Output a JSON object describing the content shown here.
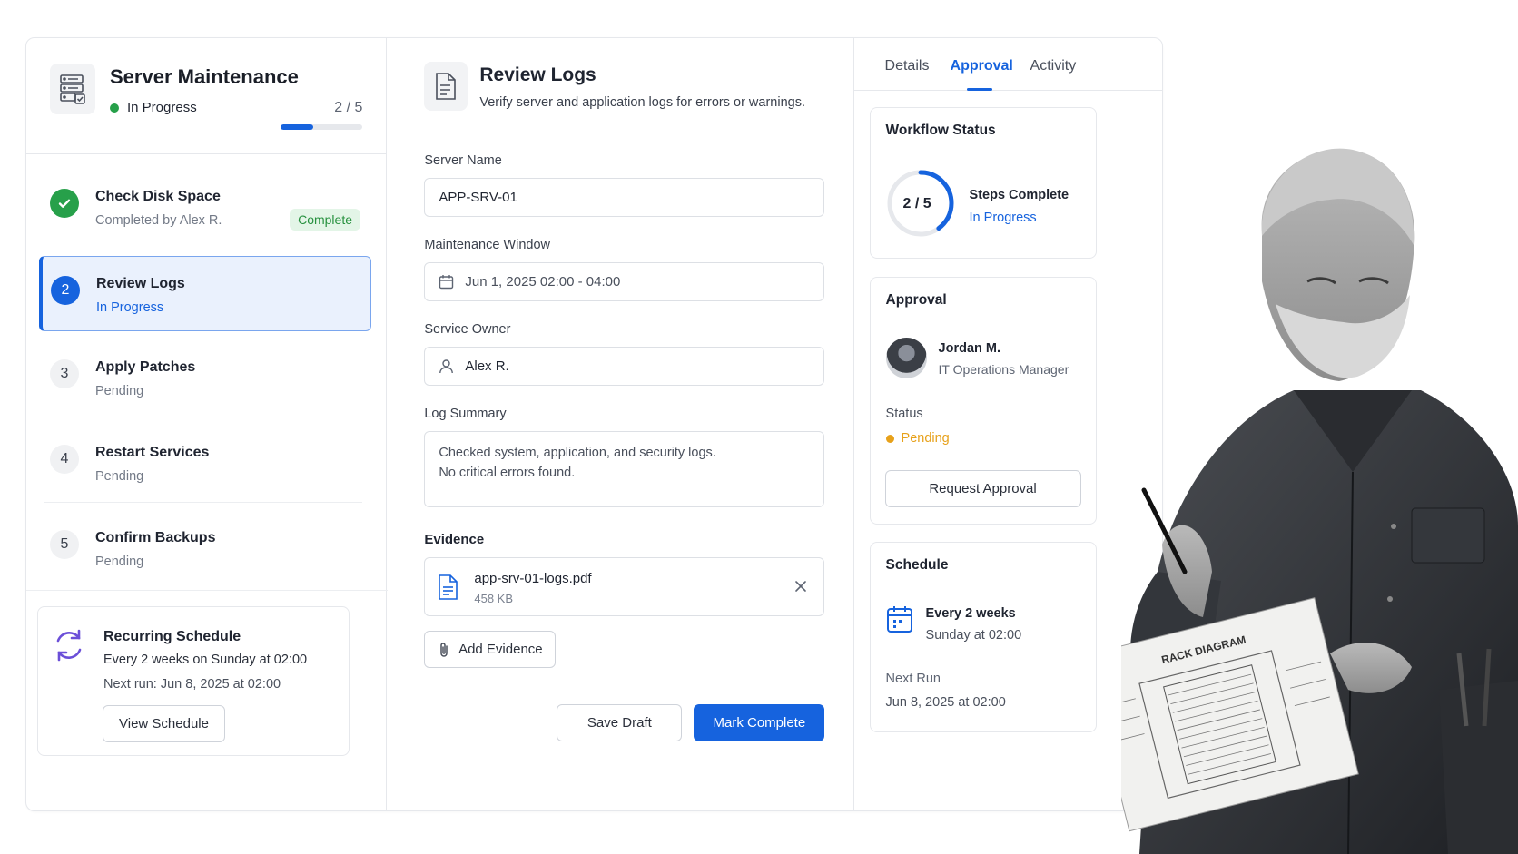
{
  "project": {
    "title": "Server Maintenance",
    "status": "In Progress",
    "progress_text": "2 / 5",
    "progress_fraction": 0.4
  },
  "steps": [
    {
      "number": "1",
      "title": "Check Disk Space",
      "subtitle": "Completed by Alex R.",
      "badge": "Complete",
      "state": "complete"
    },
    {
      "number": "2",
      "title": "Review Logs",
      "subtitle": "In Progress",
      "state": "active"
    },
    {
      "number": "3",
      "title": "Apply Patches",
      "subtitle": "Pending",
      "state": "pending"
    },
    {
      "number": "4",
      "title": "Restart Services",
      "subtitle": "Pending",
      "state": "pending"
    },
    {
      "number": "5",
      "title": "Confirm Backups",
      "subtitle": "Pending",
      "state": "pending"
    }
  ],
  "recurring": {
    "title": "Recurring Schedule",
    "frequency": "Every 2 weeks on Sunday at 02:00",
    "next_run": "Next run: Jun 8, 2025 at 02:00",
    "button": "View Schedule"
  },
  "task": {
    "title": "Review Logs",
    "description": "Verify server and application logs for errors or warnings.",
    "fields": {
      "server_name": {
        "label": "Server Name",
        "value": "APP-SRV-01"
      },
      "maintenance_window": {
        "label": "Maintenance Window",
        "value": "Jun 1, 2025 02:00 - 04:00"
      },
      "service_owner": {
        "label": "Service Owner",
        "value": "Alex R."
      },
      "log_summary": {
        "label": "Log Summary",
        "line1": "Checked system, application, and security logs.",
        "line2": "No critical errors found."
      }
    },
    "evidence": {
      "label": "Evidence",
      "file_name": "app-srv-01-logs.pdf",
      "file_size": "458 KB",
      "add_button": "Add Evidence"
    },
    "actions": {
      "save_draft": "Save Draft",
      "mark_complete": "Mark Complete"
    }
  },
  "tabs": [
    "Details",
    "Approval",
    "Activity"
  ],
  "active_tab": "Approval",
  "workflow": {
    "title": "Workflow Status",
    "count": "2 / 5",
    "label": "Steps Complete",
    "status": "In Progress",
    "fraction": 0.4
  },
  "approval": {
    "title": "Approval",
    "approver_name": "Jordan M.",
    "approver_role": "IT Operations Manager",
    "status_label": "Status",
    "status": "Pending",
    "button": "Request Approval"
  },
  "schedule": {
    "title": "Schedule",
    "frequency": "Every 2 weeks",
    "time": "Sunday at 02:00",
    "next_run_label": "Next Run",
    "next_run": "Jun 8, 2025 at 02:00"
  },
  "photo": {
    "sheet_title": "RACK DIAGRAM"
  },
  "colors": {
    "accent": "#1663de",
    "success": "#27a04a",
    "warning": "#e7a11a",
    "border": "#e6e8ec"
  },
  "icons": {
    "project": "server-checklist-icon",
    "task": "document-icon",
    "calendar": "calendar-icon",
    "user": "user-icon",
    "file": "pdf-file-icon",
    "close": "close-icon",
    "attach": "paperclip-icon",
    "recurring": "refresh-cycle-icon",
    "check": "check-icon"
  }
}
